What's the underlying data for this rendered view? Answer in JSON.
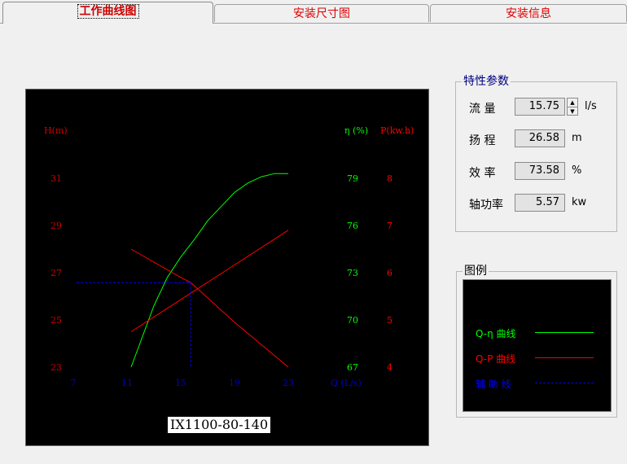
{
  "tabs": [
    {
      "label": "工作曲线图"
    },
    {
      "label": "安装尺寸图"
    },
    {
      "label": "安装信息"
    }
  ],
  "chart": {
    "model": "IX1100-80-140",
    "head_axis_label": "H(m)",
    "eff_axis_label": "η (%)",
    "power_axis_label": "P(kw.h)",
    "x_axis_label": "Q (L/s)",
    "head_ticks": [
      "31",
      "29",
      "27",
      "25",
      "23"
    ],
    "eff_ticks": [
      "79",
      "76",
      "73",
      "70",
      "67"
    ],
    "power_ticks": [
      "8",
      "7",
      "6",
      "5",
      "4"
    ],
    "x_ticks": [
      "7",
      "11",
      "15",
      "19",
      "23"
    ]
  },
  "chart_data": {
    "type": "line",
    "x_range": [
      7,
      23
    ],
    "series": [
      {
        "name": "Q-η 曲线",
        "color": "#00ff00",
        "axis": "eff",
        "points": [
          [
            11.3,
            67.0
          ],
          [
            12,
            68.6
          ],
          [
            13,
            70.9
          ],
          [
            14,
            72.7
          ],
          [
            15,
            74.0
          ],
          [
            16,
            75.1
          ],
          [
            17,
            76.3
          ],
          [
            18,
            77.2
          ],
          [
            19,
            78.1
          ],
          [
            20,
            78.7
          ],
          [
            21,
            79.1
          ],
          [
            22,
            79.3
          ],
          [
            23,
            79.3
          ]
        ]
      },
      {
        "name": "Q-P 曲线",
        "color": "#ff0000",
        "axis": "power",
        "points": [
          [
            11.3,
            4.75
          ],
          [
            23,
            6.9
          ]
        ]
      },
      {
        "name": "Q-H 曲线",
        "color": "#ff0000",
        "axis": "head",
        "points": [
          [
            11.3,
            28.0
          ],
          [
            15,
            26.8
          ],
          [
            15.75,
            26.58
          ],
          [
            19,
            24.9
          ],
          [
            23,
            23.0
          ]
        ]
      }
    ],
    "guide": {
      "name": "辅 助 线",
      "color": "#0000ff",
      "x": 15.75,
      "head": 26.58
    },
    "head_range": [
      23,
      31
    ],
    "eff_range": [
      67,
      79
    ],
    "power_range": [
      4,
      8
    ]
  },
  "params": {
    "title": "特性参数",
    "flow": {
      "label": "流  量",
      "value": "15.75",
      "unit": "l/s"
    },
    "head": {
      "label": "扬  程",
      "value": "26.58",
      "unit": "m"
    },
    "efficiency": {
      "label": "效  率",
      "value": "73.58",
      "unit": "%"
    },
    "shaft_power": {
      "label": "轴功率",
      "value": "5.57",
      "unit": "kw"
    }
  },
  "legend": {
    "title": "图例",
    "items": [
      {
        "label": "Q-η 曲线",
        "color": "#00ff00"
      },
      {
        "label": "Q-P 曲线",
        "color": "#ff0000"
      },
      {
        "label": "辅 助 线",
        "color": "#0000ff"
      }
    ]
  }
}
